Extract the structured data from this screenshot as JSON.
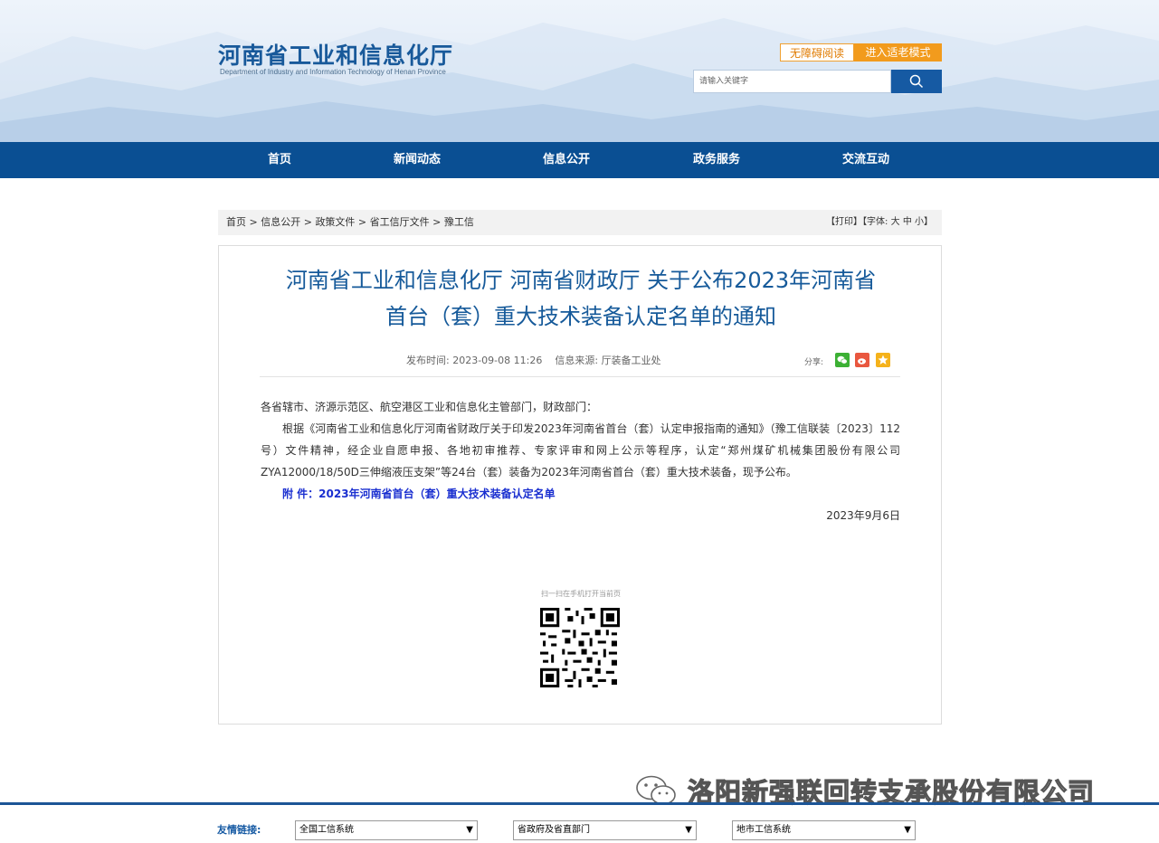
{
  "header": {
    "logo_cn": "河南省工业和信息化厅",
    "logo_en": "Department of Industry and Information Technology of Henan Province",
    "accessibility_label": "无障碍阅读",
    "elder_mode_label": "进入适老模式",
    "search_placeholder": "请输入关键字"
  },
  "nav": {
    "items": [
      {
        "label": "首页"
      },
      {
        "label": "新闻动态"
      },
      {
        "label": "信息公开"
      },
      {
        "label": "政务服务"
      },
      {
        "label": "交流互动"
      }
    ]
  },
  "breadcrumb": {
    "items": [
      "首页",
      "信息公开",
      "政策文件",
      "省工信厅文件",
      "豫工信"
    ],
    "separator": " > ",
    "print_label": "【打印】",
    "font_label": "【字体:",
    "font_large": "大",
    "font_medium": "中",
    "font_small": "小",
    "font_close": "】"
  },
  "article": {
    "title_line1": "河南省工业和信息化厅 河南省财政厅 关于公布2023年河南省",
    "title_line2": "首台（套）重大技术装备认定名单的通知",
    "publish_label": "发布时间:",
    "publish_time": "2023-09-08 11:26",
    "source_label": "信息来源:",
    "source": "厅装备工业处",
    "share_label": "分享:",
    "salutation": "各省辖市、济源示范区、航空港区工业和信息化主管部门，财政部门：",
    "paragraph": "根据《河南省工业和信息化厅河南省财政厅关于印发2023年河南省首台（套）认定申报指南的通知》（豫工信联装〔2023〕112号）文件精神，经企业自愿申报、各地初审推荐、专家评审和网上公示等程序，认定“郑州煤矿机械集团股份有限公司ZYA12000/18/50D三伸缩液压支架”等24台（套）装备为2023年河南省首台（套）重大技术装备，现予公布。",
    "attachment": "附 件：2023年河南省首台（套）重大技术装备认定名单",
    "date": "2023年9月6日",
    "qr_caption": "扫一扫在手机打开当前页"
  },
  "watermark": {
    "text": "洛阳新强联回转支承股份有限公司"
  },
  "footer": {
    "links_label": "友情链接:",
    "selects": [
      "全国工信系统",
      "省政府及省直部门",
      "地市工信系统"
    ]
  },
  "colors": {
    "brand_blue": "#0a4f93",
    "title_blue": "#165a9a",
    "orange": "#f29b1d",
    "attachment_blue": "#1a2fd0"
  }
}
